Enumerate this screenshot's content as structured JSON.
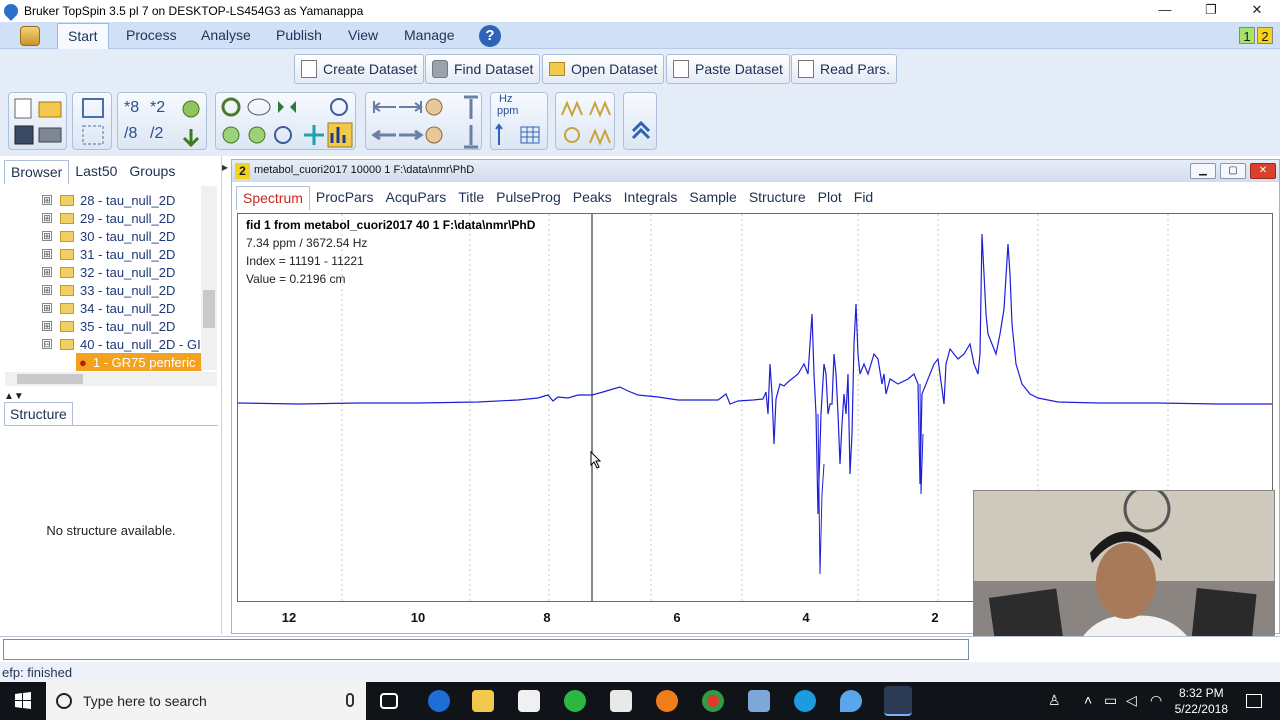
{
  "window": {
    "title": "Bruker TopSpin 3.5 pl 7 on DESKTOP-LS454G3 as Yamanappa",
    "controls": [
      "—",
      "❐",
      "✕"
    ]
  },
  "menu": {
    "items": [
      "Start",
      "Process",
      "Analyse",
      "Publish",
      "View",
      "Manage"
    ],
    "active": "Start",
    "help": "?",
    "window_numbers": [
      "1",
      "2"
    ]
  },
  "dataset_buttons": [
    "Create Dataset",
    "Find Dataset",
    "Open Dataset",
    "Paste Dataset",
    "Read Pars."
  ],
  "toolbar_glyphs": {
    "scale_up": "*8",
    "scale_up2": "*2",
    "scale_down": "/8",
    "scale_down2": "/2",
    "ppm": "ppm",
    "hz": "Hz",
    "ppm_unit": "ppm"
  },
  "browser": {
    "tabs": [
      "Browser",
      "Last50",
      "Groups"
    ],
    "active_tab": "Browser",
    "tree": [
      "28 - tau_null_2D",
      "29 - tau_null_2D",
      "30 - tau_null_2D",
      "31 - tau_null_2D",
      "32 - tau_null_2D",
      "33 - tau_null_2D",
      "34 - tau_null_2D",
      "35 - tau_null_2D",
      "40 - tau_null_2D - GI"
    ],
    "selected_child": "1 - GR75 penferic",
    "collapsed_marker": "⊞",
    "expanded_marker": "⊟"
  },
  "structure": {
    "tab": "Structure",
    "message": "No structure available."
  },
  "spectrum_window": {
    "number": "2",
    "title": "metabol_cuori2017  10000  1  F:\\data\\nmr\\PhD",
    "tabs": [
      "Spectrum",
      "ProcPars",
      "AcquPars",
      "Title",
      "PulseProg",
      "Peaks",
      "Integrals",
      "Sample",
      "Structure",
      "Plot",
      "Fid"
    ],
    "active_tab": "Spectrum",
    "info": {
      "dataset": "fid 1 from metabol_cuori2017  40  1  F:\\data\\nmr\\PhD",
      "position": "7.34 ppm / 3672.54 Hz",
      "index": "Index = 11191 - 11221",
      "value": "Value = 0.2196     cm"
    },
    "x_ticks": [
      "12",
      "10",
      "8",
      "6",
      "4",
      "2"
    ],
    "trace_color": "#1f1fd8"
  },
  "command_line": {
    "value": ""
  },
  "status": {
    "text": "efp: finished"
  },
  "taskbar": {
    "search_placeholder": "Type here to search",
    "time": "8:32 PM",
    "date": "5/22/2018",
    "apps": [
      "task-view",
      "edge",
      "file-explorer",
      "store",
      "whatsapp",
      "mail",
      "firefox",
      "chrome",
      "rdp",
      "skype",
      "topspin-a",
      "topspin-b"
    ]
  },
  "colors": {
    "menubar_bg": "#cfe0f7",
    "toolbar_bg": "#e4ecf8",
    "active_tab_text": "#c8281e",
    "selection": "#f2a21f",
    "spectrum": "#1f1fd8"
  }
}
